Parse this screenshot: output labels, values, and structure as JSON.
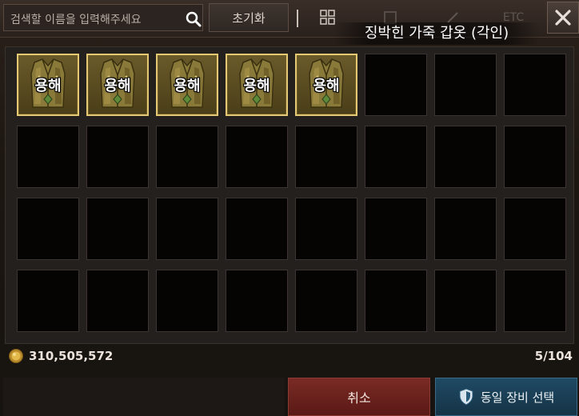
{
  "search": {
    "placeholder": "검색할 이름을 입력해주세요",
    "icon": "search-icon"
  },
  "toolbar": {
    "reset_label": "초기화",
    "tabs": [
      {
        "name": "grid-view-tab",
        "label": "",
        "icon": "grid-icon"
      },
      {
        "name": "tab-2",
        "label": ""
      },
      {
        "name": "tab-3",
        "label": ""
      },
      {
        "name": "tab-etc",
        "label": "ETC"
      }
    ],
    "close_icon": "close-icon"
  },
  "item": {
    "title": "징박힌 가죽 갑옷 (각인)"
  },
  "inventory": {
    "filled_label": "용해",
    "filled_count": 5,
    "visible_slots": 32
  },
  "footer": {
    "currency_icon": "coin-icon",
    "currency_amount": "310,505,572",
    "slot_count": "5/104"
  },
  "actions": {
    "cancel_label": "취소",
    "confirm_label": "동일 장비 선택",
    "confirm_icon": "shield-icon"
  },
  "colors": {
    "slot_border_selected": "#e5c873",
    "cancel_button": "#6a2320",
    "confirm_button": "#1a3e55"
  }
}
